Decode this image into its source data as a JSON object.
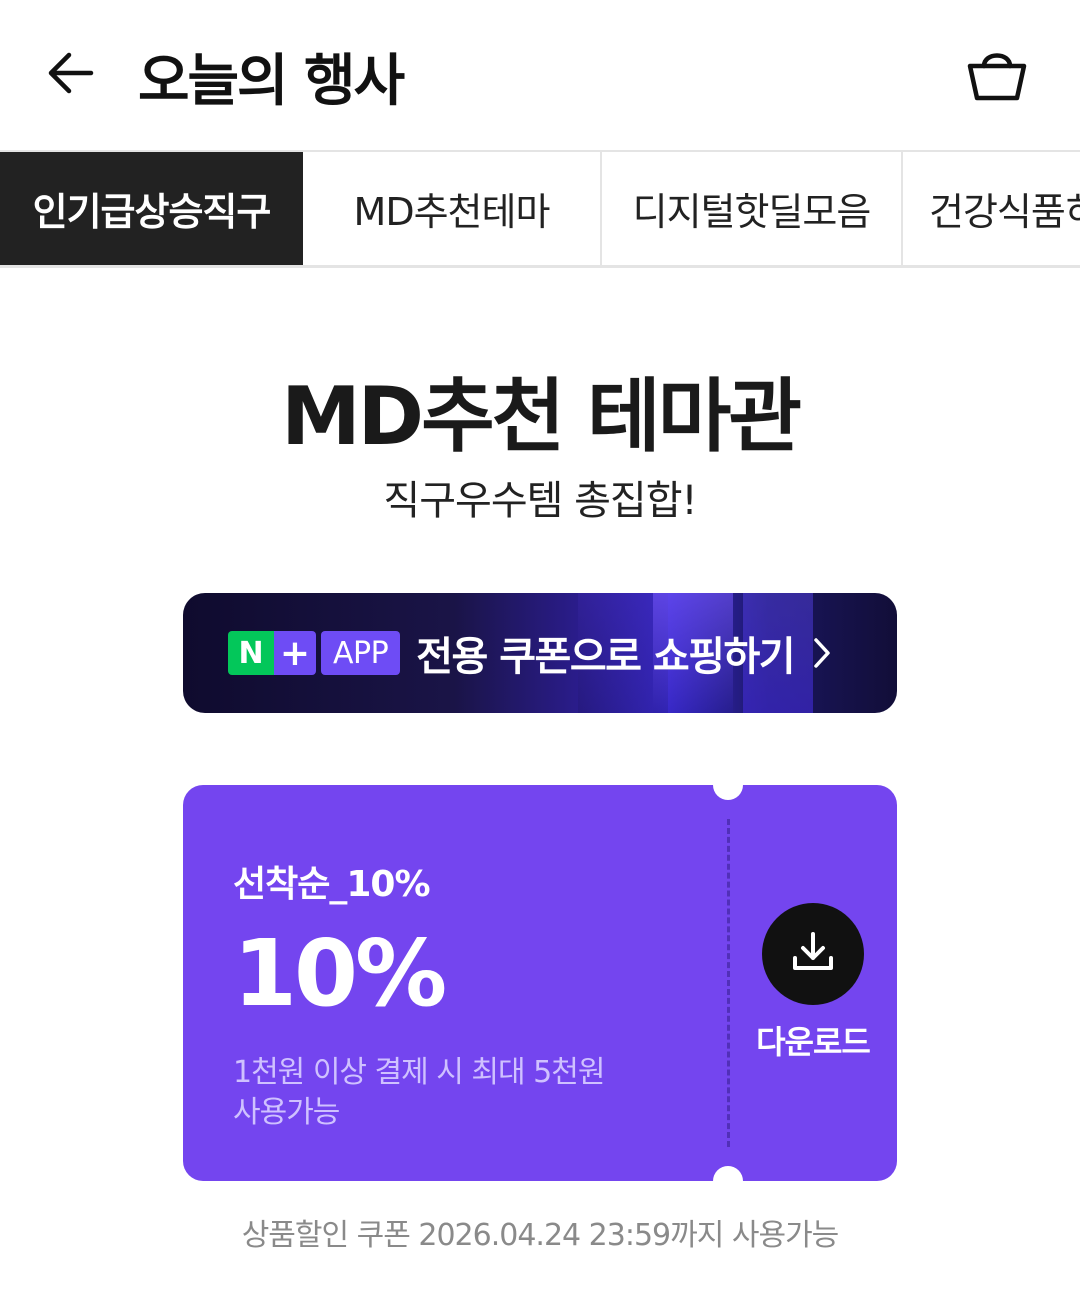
{
  "header": {
    "title": "오늘의 행사",
    "back_icon": "arrow-left-icon",
    "cart_icon": "shopping-bag-icon"
  },
  "tabs": [
    {
      "label": "인기급상승직구",
      "active": true
    },
    {
      "label": "MD추천테마",
      "active": false
    },
    {
      "label": "디지털핫딜모음",
      "active": false
    },
    {
      "label": "건강식품히",
      "active": false
    }
  ],
  "hero": {
    "title": "MD추천 테마관",
    "subtitle": "직구우수템 총집합!"
  },
  "app_banner": {
    "badge_n": "N",
    "badge_plus": "+",
    "badge_app": "APP",
    "text": "전용 쿠폰으로 쇼핑하기",
    "chevron_icon": "chevron-right-icon"
  },
  "coupon": {
    "name": "선착순_10%",
    "amount": "10%",
    "condition_line1": "1천원 이상 결제 시 최대 5천원",
    "condition_line2": "사용가능",
    "download_label": "다운로드",
    "download_icon": "download-icon",
    "color": "#7445ef"
  },
  "footnote": "상품할인 쿠폰 2026.04.24 23:59까지 사용가능",
  "colors": {
    "active_tab_bg": "#222222",
    "naver_green": "#03c75a",
    "plus_purple": "#6e4cf5"
  }
}
